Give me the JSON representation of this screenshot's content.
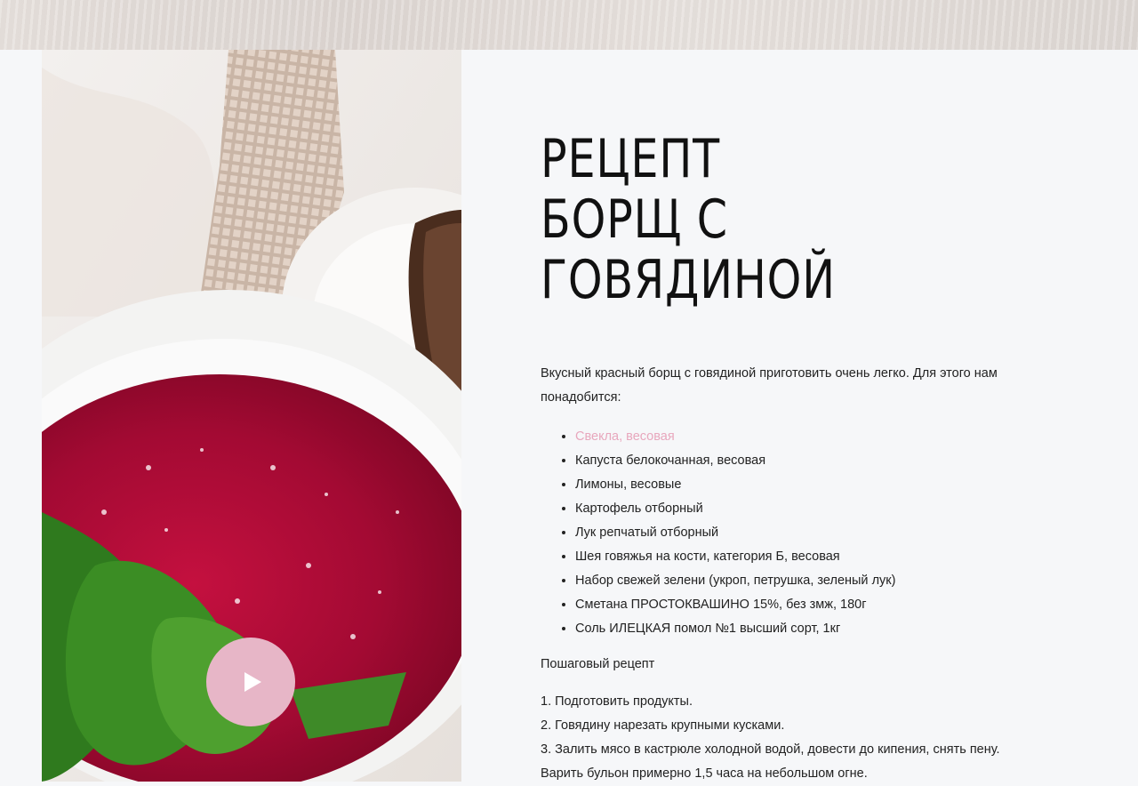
{
  "header": {
    "title_line1": "РЕЦЕПТ",
    "title_line2": "БОРЩ С",
    "title_line3": "ГОВЯДИНОЙ"
  },
  "intro": "Вкусный красный борщ с говядиной приготовить очень легко. Для этого нам понадобится:",
  "ingredients": [
    "Свекла, весовая",
    "Капуста белокочанная, весовая",
    "Лимоны, весовые",
    "Картофель отборный",
    "Лук репчатый отборный",
    "Шея говяжья на кости, категория Б, весовая",
    "Набор свежей зелени (укроп, петрушка, зеленый лук)",
    "Сметана ПРОСТОКВАШИНО 15%, без змж, 180г",
    "Соль ИЛЕЦКАЯ помол №1 высший сорт, 1кг"
  ],
  "steps_heading": "Пошаговый рецепт",
  "steps": [
    "1. Подготовить продукты.",
    "2. Говядину нарезать крупными кусками.",
    "3. Залить мясо в кастрюле холодной водой, довести до кипения, снять пену. Варить бульон примерно 1,5 часа на небольшом огне."
  ],
  "colors": {
    "link": "#e8a7bd",
    "play_button": "#e7b6c7",
    "page_bg": "#f6f7f9"
  },
  "icons": {
    "play": "play-icon"
  }
}
